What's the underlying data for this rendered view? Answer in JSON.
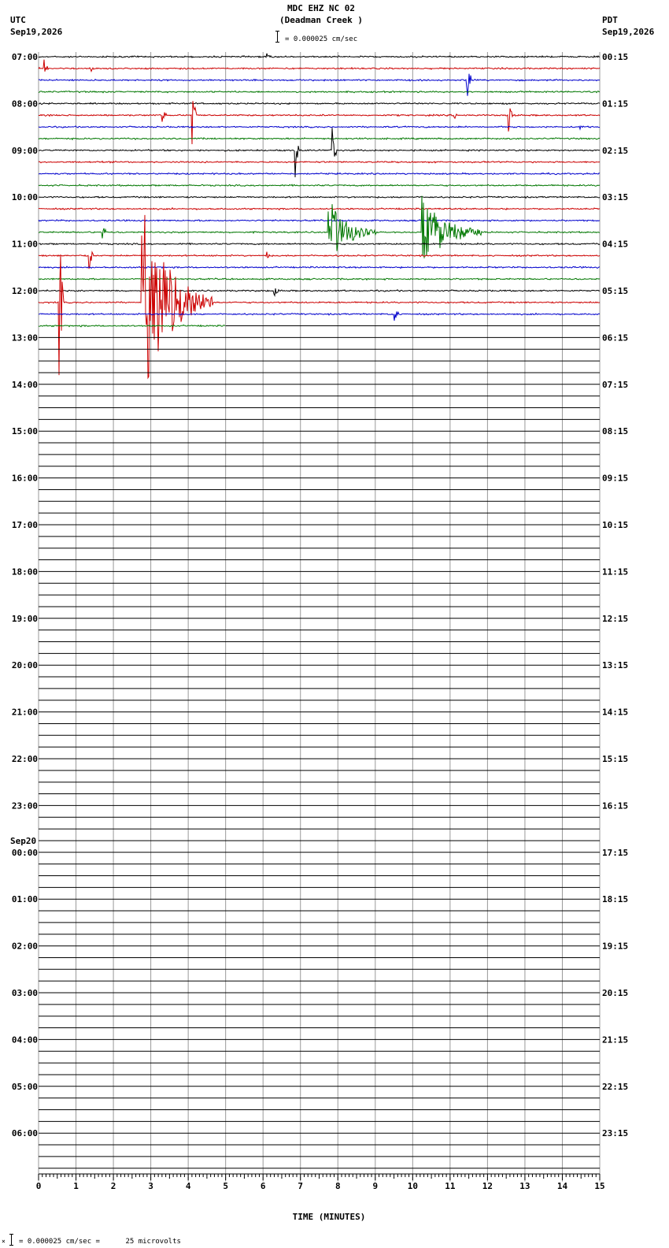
{
  "header": {
    "station": "MDC EHZ NC 02",
    "site": "(Deadman Creek )",
    "left_tz": "UTC",
    "left_date": "Sep19,2026",
    "right_tz": "PDT",
    "right_date": "Sep19,2026",
    "scale_text": "= 0.000025 cm/sec"
  },
  "footer": {
    "scale_text": "= 0.000025 cm/sec =      25 microvolts"
  },
  "chart_data": {
    "type": "line",
    "title": "MDC EHZ NC 02 (Deadman Creek )",
    "xlabel": "TIME (MINUTES)",
    "xlim": [
      0,
      15
    ],
    "x_ticks": [
      "0",
      "1",
      "2",
      "3",
      "4",
      "5",
      "6",
      "7",
      "8",
      "9",
      "10",
      "11",
      "12",
      "13",
      "14",
      "15"
    ],
    "traces_per_hour": 4,
    "total_traces": 96,
    "trace_colors": [
      "#000000",
      "#cc0000",
      "#0000cc",
      "#007700"
    ],
    "left_labels": [
      "07:00",
      "08:00",
      "09:00",
      "10:00",
      "11:00",
      "12:00",
      "13:00",
      "14:00",
      "15:00",
      "16:00",
      "17:00",
      "18:00",
      "19:00",
      "20:00",
      "21:00",
      "22:00",
      "23:00",
      "00:00",
      "01:00",
      "02:00",
      "03:00",
      "04:00",
      "05:00",
      "06:00"
    ],
    "right_labels": [
      "00:15",
      "01:15",
      "02:15",
      "03:15",
      "04:15",
      "05:15",
      "06:15",
      "07:15",
      "08:15",
      "09:15",
      "10:15",
      "11:15",
      "12:15",
      "13:15",
      "14:15",
      "15:15",
      "16:15",
      "17:15",
      "18:15",
      "19:15",
      "20:15",
      "21:15",
      "22:15",
      "23:15"
    ],
    "date_change": {
      "hour_index": 17,
      "label": "Sep20"
    },
    "recorded_traces": 24,
    "last_trace_end_minute": 5.0,
    "events": [
      {
        "trace": 1,
        "minute": 0.15,
        "amp": 14
      },
      {
        "trace": 1,
        "minute": 1.4,
        "amp": 6
      },
      {
        "trace": 0,
        "minute": 6.1,
        "amp": 5
      },
      {
        "trace": 2,
        "minute": 11.45,
        "amp": 34
      },
      {
        "trace": 5,
        "minute": 4.1,
        "amp": 44
      },
      {
        "trace": 5,
        "minute": 3.3,
        "amp": 10
      },
      {
        "trace": 5,
        "minute": 11.1,
        "amp": 7
      },
      {
        "trace": 5,
        "minute": 12.55,
        "amp": 26
      },
      {
        "trace": 6,
        "minute": 14.45,
        "amp": 10
      },
      {
        "trace": 8,
        "minute": 6.85,
        "amp": 40
      },
      {
        "trace": 8,
        "minute": 7.85,
        "amp": 34
      },
      {
        "trace": 15,
        "minute": 1.7,
        "amp": 24
      },
      {
        "trace": 15,
        "minute": 7.75,
        "amp": 44,
        "coda_min": 1.3
      },
      {
        "trace": 15,
        "minute": 10.25,
        "amp": 48,
        "coda_min": 1.6
      },
      {
        "trace": 17,
        "minute": 1.35,
        "amp": 20
      },
      {
        "trace": 17,
        "minute": 6.1,
        "amp": 6
      },
      {
        "trace": 20,
        "minute": 6.3,
        "amp": 8
      },
      {
        "trace": 21,
        "minute": 0.55,
        "amp": 130
      },
      {
        "trace": 21,
        "minute": 2.75,
        "amp": 130,
        "coda_min": 1.9
      },
      {
        "trace": 22,
        "minute": 9.5,
        "amp": 16
      }
    ]
  }
}
